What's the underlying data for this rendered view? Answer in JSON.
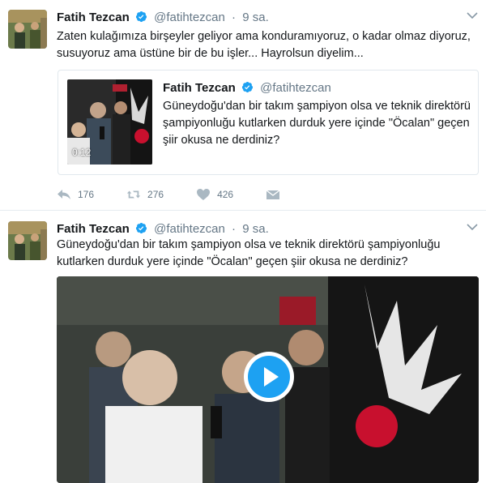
{
  "colors": {
    "accent": "#1da1f2",
    "name": "#14171a",
    "muted": "#657786",
    "divider": "#e6ecf0"
  },
  "tweets": [
    {
      "author_name": "Fatih Tezcan",
      "author_handle": "@fatihtezcan",
      "separator": "·",
      "time": "9 sa.",
      "text": "Zaten kulağımıza birşeyler geliyor ama konduramıyoruz, o kadar olmaz diyoruz, susuyoruz ama üstüne bir de bu işler... Hayrolsun diyelim...",
      "quote": {
        "author_name": "Fatih Tezcan",
        "author_handle": "@fatihtezcan",
        "text": "Güneydoğu'dan bir takım şampiyon olsa ve teknik direktörü şampiyonluğu kutlarken durduk yere içinde \"Öcalan\" geçen şiir okusa ne derdiniz?",
        "video_duration": "0:12"
      },
      "actions": {
        "reply_count": "176",
        "retweet_count": "276",
        "like_count": "426"
      }
    },
    {
      "author_name": "Fatih Tezcan",
      "author_handle": "@fatihtezcan",
      "separator": "·",
      "time": "9 sa.",
      "text": "Güneydoğu'dan bir takım şampiyon olsa ve teknik direktörü şampiyonluğu kutlarken durduk yere içinde \"Öcalan\" geçen şiir okusa ne derdiniz?"
    }
  ],
  "icons": {
    "verified": "verified-badge-icon",
    "caret": "chevron-down-icon",
    "reply": "reply-icon",
    "retweet": "retweet-icon",
    "like": "heart-icon",
    "dm": "envelope-icon",
    "play": "play-icon"
  }
}
